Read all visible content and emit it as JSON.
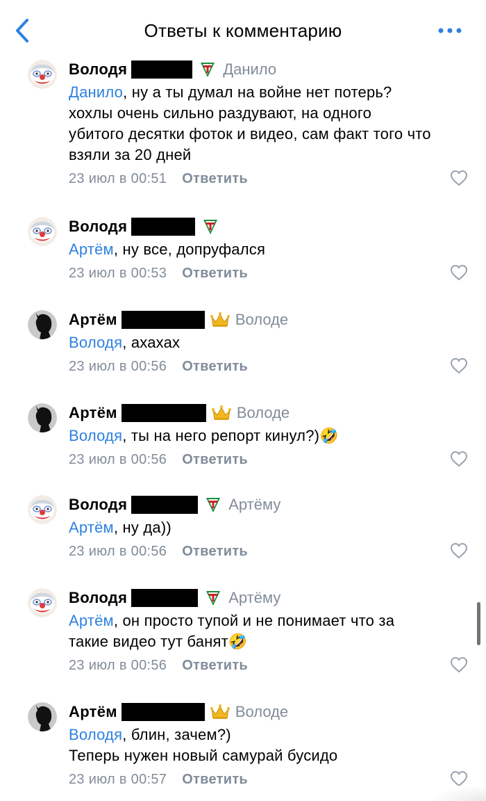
{
  "header": {
    "title": "Ответы к комментарию",
    "back_icon": "chevron-left-icon",
    "more_icon": "more-dots-icon"
  },
  "colors": {
    "accent": "#2d81e0",
    "muted": "#818c99",
    "redaction": "#000000"
  },
  "comments": [
    {
      "author": "Володя",
      "avatar": "clown-avatar",
      "badge": "torpedo-badge-icon",
      "reply_to": "Данило",
      "mention": "Данило",
      "lines": [
        ", ну а ты думал на войне нет потерь?",
        "хохлы очень сильно раздувают, на одного",
        "убитого десятки фоток и видео, сам факт того что",
        "взяли за 20 дней"
      ],
      "time": "23 июл в 00:51",
      "reply_label": "Ответить"
    },
    {
      "author": "Володя",
      "avatar": "clown-avatar",
      "badge": "torpedo-badge-icon",
      "reply_to": "",
      "mention": "Артём",
      "lines": [
        ", ну все, допруфался"
      ],
      "time": "23 июл в 00:53",
      "reply_label": "Ответить"
    },
    {
      "author": "Артём",
      "avatar": "silhouette-avatar",
      "badge": "crown-badge-icon",
      "reply_to": "Володе",
      "mention": "Володя",
      "lines": [
        ", ахахах"
      ],
      "time": "23 июл в 00:56",
      "reply_label": "Ответить"
    },
    {
      "author": "Артём",
      "avatar": "silhouette-avatar",
      "badge": "crown-badge-icon",
      "reply_to": "Володе",
      "mention": "Володя",
      "lines": [
        ", ты на него репорт кинул?)🤣"
      ],
      "time": "23 июл в 00:56",
      "reply_label": "Ответить"
    },
    {
      "author": "Володя",
      "avatar": "clown-avatar",
      "badge": "torpedo-badge-icon",
      "reply_to": "Артёму",
      "mention": "Артём",
      "lines": [
        ", ну да))"
      ],
      "time": "23 июл в 00:56",
      "reply_label": "Ответить"
    },
    {
      "author": "Володя",
      "avatar": "clown-avatar",
      "badge": "torpedo-badge-icon",
      "reply_to": "Артёму",
      "mention": "Артём",
      "lines": [
        ", он просто тупой и не понимает что за",
        "такие видео тут банят🤣"
      ],
      "time": "23 июл в 00:56",
      "reply_label": "Ответить"
    },
    {
      "author": "Артём",
      "avatar": "silhouette-avatar",
      "badge": "crown-badge-icon",
      "reply_to": "Володе",
      "mention": "Володя",
      "lines": [
        ", блин, зачем?)",
        "Теперь нужен новый самурай бусидо"
      ],
      "time": "23 июл в 00:57",
      "reply_label": "Ответить"
    }
  ]
}
